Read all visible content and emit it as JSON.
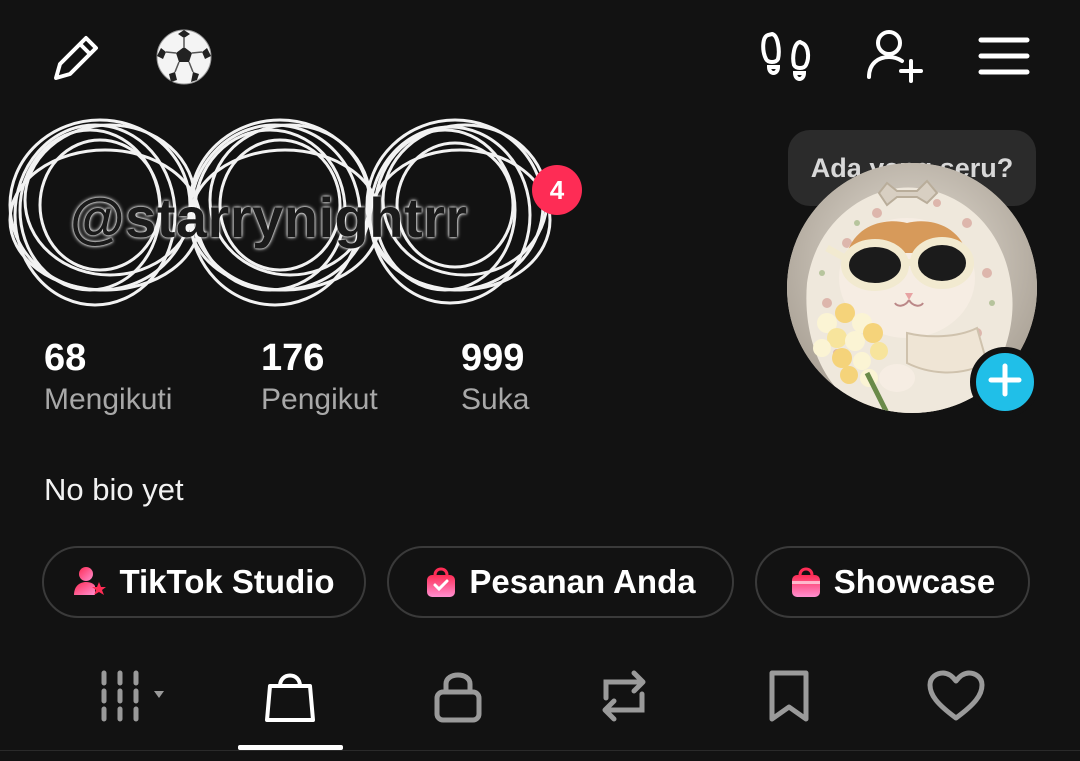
{
  "topbar": {
    "left_icons": [
      "pencil-icon",
      "soccer-ball-icon"
    ],
    "right_icons": [
      "footprints-icon",
      "add-friend-icon",
      "menu-icon"
    ]
  },
  "profile": {
    "username": "@starrynightrr",
    "notification_badge": "4",
    "bio": "No bio yet"
  },
  "stats": [
    {
      "value": "68",
      "label": "Mengikuti"
    },
    {
      "value": "176",
      "label": "Pengikut"
    },
    {
      "value": "999",
      "label": "Suka"
    }
  ],
  "avatar": {
    "tooltip": "Ada yang seru?",
    "description_icon": "cat-avatar"
  },
  "buttons": [
    {
      "label": "TikTok Studio",
      "icon": "studio-icon"
    },
    {
      "label": "Pesanan Anda",
      "icon": "shopping-bag-check-icon"
    },
    {
      "label": "Showcase",
      "icon": "shopping-bag-icon"
    }
  ],
  "tabs": [
    {
      "icon": "grid-icon",
      "active": false
    },
    {
      "icon": "shop-bag-icon",
      "active": true
    },
    {
      "icon": "lock-icon",
      "active": false
    },
    {
      "icon": "repost-icon",
      "active": false
    },
    {
      "icon": "bookmark-icon",
      "active": false
    },
    {
      "icon": "heart-icon",
      "active": false
    }
  ],
  "colors": {
    "background": "#121212",
    "badge": "#fe2c55",
    "accent_blue": "#20bfe8",
    "pink_gradient_start": "#fe2c55",
    "pink_gradient_end": "#ff8fd0"
  }
}
